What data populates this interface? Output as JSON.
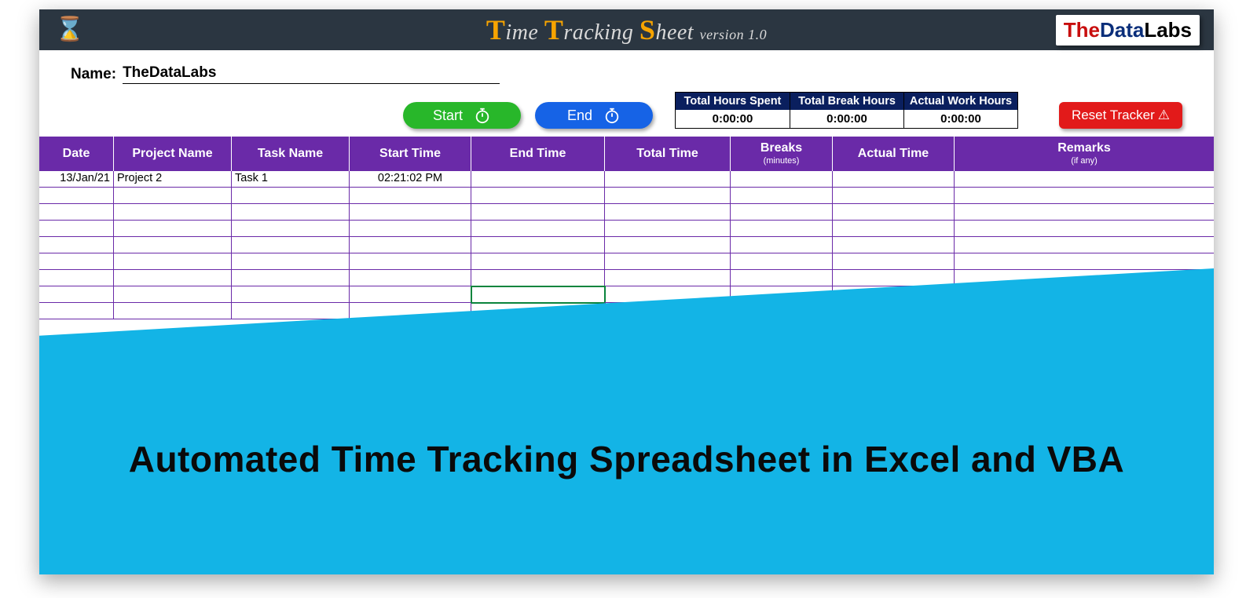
{
  "header": {
    "title_words": {
      "t1": "T",
      "w1": "ime ",
      "t2": "T",
      "w2": "racking ",
      "t3": "S",
      "w3": "heet ",
      "ver": "version 1.0"
    },
    "logo": {
      "the": "The",
      "data": "Data",
      "labs": "Labs"
    }
  },
  "name": {
    "label": "Name:",
    "value": "TheDataLabs"
  },
  "buttons": {
    "start": "Start",
    "end": "End",
    "reset": "Reset Tracker"
  },
  "summary": {
    "cols": [
      {
        "label": "Total Hours Spent",
        "value": "0:00:00"
      },
      {
        "label": "Total Break Hours",
        "value": "0:00:00"
      },
      {
        "label": "Actual Work Hours",
        "value": "0:00:00"
      }
    ]
  },
  "grid": {
    "headers": {
      "date": "Date",
      "project": "Project Name",
      "task": "Task Name",
      "start": "Start Time",
      "end": "End Time",
      "total": "Total Time",
      "breaks": "Breaks",
      "breaks_sub": "(minutes)",
      "actual": "Actual Time",
      "remarks": "Remarks",
      "remarks_sub": "(if any)"
    },
    "rows": [
      {
        "date": "13/Jan/21",
        "project": "Project 2",
        "task": "Task 1",
        "start": "02:21:02 PM",
        "end": "",
        "total": "",
        "breaks": "",
        "actual": "",
        "remarks": ""
      },
      {
        "date": "",
        "project": "",
        "task": "",
        "start": "",
        "end": "",
        "total": "",
        "breaks": "",
        "actual": "",
        "remarks": ""
      },
      {
        "date": "",
        "project": "",
        "task": "",
        "start": "",
        "end": "",
        "total": "",
        "breaks": "",
        "actual": "",
        "remarks": ""
      },
      {
        "date": "",
        "project": "",
        "task": "",
        "start": "",
        "end": "",
        "total": "",
        "breaks": "",
        "actual": "",
        "remarks": ""
      },
      {
        "date": "",
        "project": "",
        "task": "",
        "start": "",
        "end": "",
        "total": "",
        "breaks": "",
        "actual": "",
        "remarks": ""
      },
      {
        "date": "",
        "project": "",
        "task": "",
        "start": "",
        "end": "",
        "total": "",
        "breaks": "",
        "actual": "",
        "remarks": ""
      },
      {
        "date": "",
        "project": "",
        "task": "",
        "start": "",
        "end": "",
        "total": "",
        "breaks": "",
        "actual": "",
        "remarks": ""
      },
      {
        "date": "",
        "project": "",
        "task": "",
        "start": "",
        "end": "",
        "total": "",
        "breaks": "",
        "actual": "",
        "remarks": ""
      },
      {
        "date": "",
        "project": "",
        "task": "",
        "start": "",
        "end": "",
        "total": "",
        "breaks": "",
        "actual": "",
        "remarks": ""
      }
    ],
    "selected_cell": {
      "row": 7,
      "col": "end"
    }
  },
  "overlay": {
    "caption": "Automated Time Tracking Spreadsheet in Excel and VBA"
  }
}
